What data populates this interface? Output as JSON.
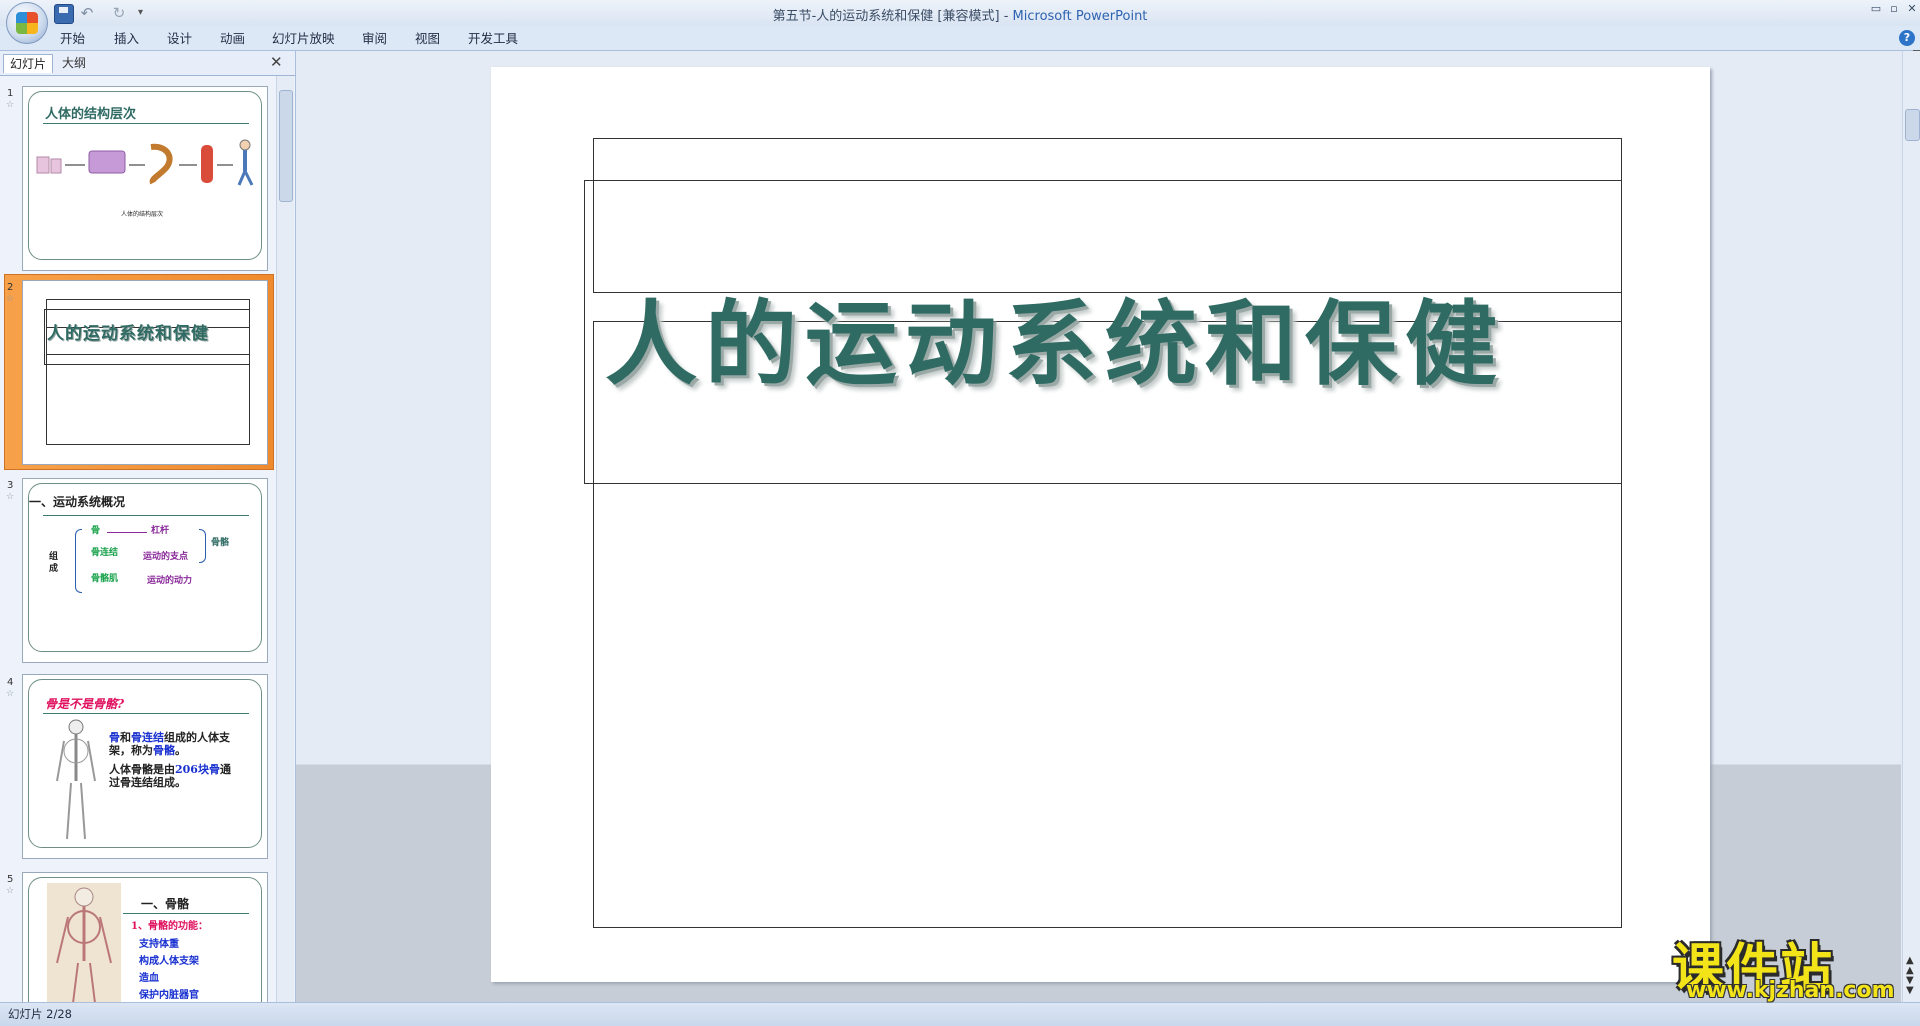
{
  "window": {
    "title": "第五节-人的运动系统和保健 [兼容模式] - ",
    "app_name": "Microsoft PowerPoint",
    "min_label": "▭",
    "max_label": "▫",
    "close_label": "✕"
  },
  "qat": {
    "undo": "↶",
    "redo": "↻",
    "more": "▾"
  },
  "ribbon": {
    "tabs": [
      "开始",
      "插入",
      "设计",
      "动画",
      "幻灯片放映",
      "审阅",
      "视图",
      "开发工具"
    ],
    "help": "?"
  },
  "pane": {
    "tabs": [
      "幻灯片",
      "大纲"
    ],
    "close": "✕",
    "thumbnails": [
      {
        "num": "1",
        "title": "人体的结构层次",
        "caption": "人体的结构层次"
      },
      {
        "num": "2",
        "title": "人的运动系统和保健"
      },
      {
        "num": "3",
        "title": "一、运动系统概况",
        "items": [
          "组成",
          "骨",
          "杠杆",
          "骨骼",
          "骨连结",
          "运动的支点",
          "骨骼肌",
          "运动的动力"
        ]
      },
      {
        "num": "4",
        "title": "骨是不是骨骼?",
        "bullets": [
          {
            "parts": [
              "骨",
              "和",
              "骨连结",
              "组成的人体支架，称为",
              "骨骼",
              "。"
            ]
          },
          {
            "parts": [
              "人体骨骼是由",
              "206块骨",
              "通过骨连结组成。"
            ]
          }
        ]
      },
      {
        "num": "5",
        "title": "一、骨骼",
        "subtitle": "1、骨骼的功能：",
        "items": [
          "支持体重",
          "构成人体支架",
          "造血",
          "保护内脏器官"
        ]
      }
    ]
  },
  "slide": {
    "title": "人的运动系统和保健"
  },
  "status": {
    "text": "幻灯片 2/28"
  },
  "watermark": {
    "brand": "课件站",
    "url": "www.kjzhan.com"
  }
}
